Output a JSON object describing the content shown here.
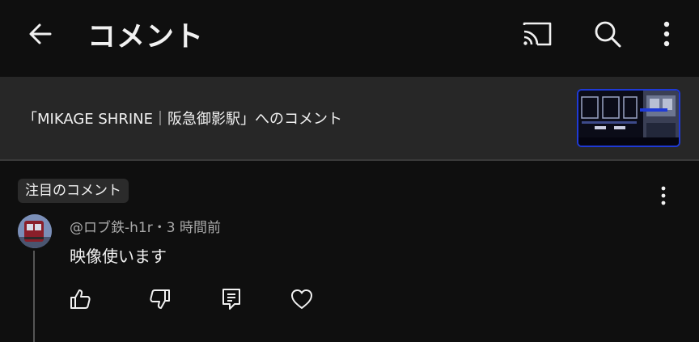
{
  "header": {
    "title": "コメント"
  },
  "video": {
    "context_text": "「MIKAGE SHRINE｜阪急御影駅」へのコメント"
  },
  "featured": {
    "chip_label": "注目のコメント"
  },
  "comment": {
    "author": "@ロブ鉄-h1r",
    "separator": "・",
    "time": "3 時間前",
    "text": "映像使います"
  },
  "icons": {
    "back": "arrow-left-icon",
    "cast": "cast-icon",
    "search": "search-icon",
    "more": "more-vert-icon",
    "like": "thumb-up-icon",
    "dislike": "thumb-down-icon",
    "reply": "reply-comment-icon",
    "heart": "heart-icon"
  },
  "colors": {
    "background": "#0f0f0f",
    "strip": "#272727",
    "text_primary": "#f1f1f1",
    "text_secondary": "#aaaaaa",
    "thumb_border": "#1f3ad6"
  }
}
